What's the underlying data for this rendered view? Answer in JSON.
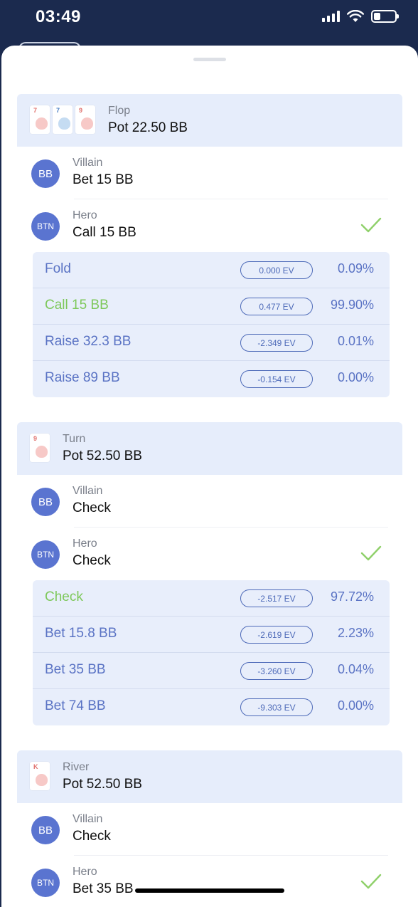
{
  "status": {
    "time": "03:49"
  },
  "streets": [
    {
      "name": "Flop",
      "pot": "Pot 22.50 BB",
      "board": [
        {
          "rank": "7",
          "suit_color": "#e0706c",
          "blob": "#f7c9c7"
        },
        {
          "rank": "7",
          "suit_color": "#4a7fc4",
          "blob": "#c5dcf2"
        },
        {
          "rank": "9",
          "suit_color": "#e0706c",
          "blob": "#f7c9c7"
        }
      ],
      "villain": {
        "avatar": "BB",
        "role": "Villain",
        "action": "Bet 15 BB"
      },
      "hero": {
        "avatar": "BTN",
        "role": "Hero",
        "action": "Call 15 BB"
      },
      "options": [
        {
          "label": "Fold",
          "ev": "0.000 EV",
          "pct": "0.09%",
          "best": false
        },
        {
          "label": "Call 15 BB",
          "ev": "0.477 EV",
          "pct": "99.90%",
          "best": true
        },
        {
          "label": "Raise 32.3 BB",
          "ev": "-2.349 EV",
          "pct": "0.01%",
          "best": false
        },
        {
          "label": "Raise 89 BB",
          "ev": "-0.154 EV",
          "pct": "0.00%",
          "best": false
        }
      ]
    },
    {
      "name": "Turn",
      "pot": "Pot 52.50 BB",
      "board": [
        {
          "rank": "9",
          "suit_color": "#e0706c",
          "blob": "#f7c9c7"
        }
      ],
      "villain": {
        "avatar": "BB",
        "role": "Villain",
        "action": "Check"
      },
      "hero": {
        "avatar": "BTN",
        "role": "Hero",
        "action": "Check"
      },
      "options": [
        {
          "label": "Check",
          "ev": "-2.517 EV",
          "pct": "97.72%",
          "best": true
        },
        {
          "label": "Bet 15.8 BB",
          "ev": "-2.619 EV",
          "pct": "2.23%",
          "best": false
        },
        {
          "label": "Bet 35 BB",
          "ev": "-3.260 EV",
          "pct": "0.04%",
          "best": false
        },
        {
          "label": "Bet 74 BB",
          "ev": "-9.303 EV",
          "pct": "0.00%",
          "best": false
        }
      ]
    },
    {
      "name": "River",
      "pot": "Pot 52.50 BB",
      "board": [
        {
          "rank": "K",
          "suit_color": "#e0706c",
          "blob": "#f7c9c7"
        }
      ],
      "villain": {
        "avatar": "BB",
        "role": "Villain",
        "action": "Check"
      },
      "hero": {
        "avatar": "BTN",
        "role": "Hero",
        "action": "Bet 35 BB"
      }
    }
  ],
  "colors": {
    "accent": "#5a74d0",
    "best": "#7dc85a",
    "header_bg": "#e6edfb"
  }
}
